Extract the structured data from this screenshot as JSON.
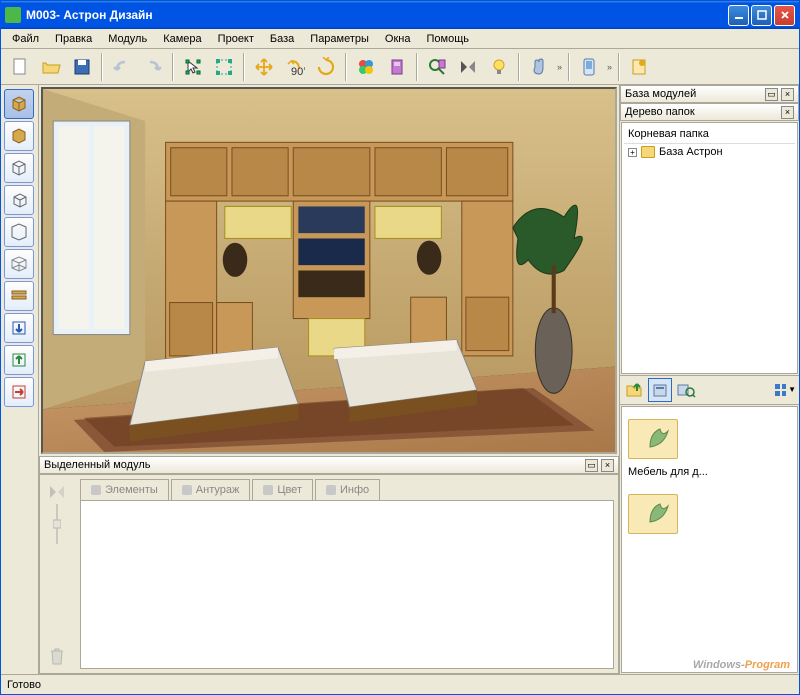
{
  "window": {
    "title": "M003- Астрон Дизайн"
  },
  "menu": {
    "items": [
      "Файл",
      "Правка",
      "Модуль",
      "Камера",
      "Проект",
      "База",
      "Параметры",
      "Окна",
      "Помощь"
    ]
  },
  "toolbar": {
    "icons": [
      "new-file",
      "open-folder",
      "save",
      "undo",
      "redo",
      "pointer",
      "select-box",
      "move",
      "rotate-90",
      "rotate-free",
      "color-palette",
      "door",
      "magnify-door",
      "mirror",
      "lightbulb",
      "hand",
      "phone",
      "export"
    ]
  },
  "left_tools": {
    "icons": [
      "primitive-generic",
      "primitive-box",
      "primitive-cube-front",
      "primitive-cube-back",
      "primitive-cylinder",
      "primitive-wireframe",
      "shelf",
      "arrow-down-blue",
      "arrow-up-green",
      "arrow-right-red"
    ]
  },
  "panels": {
    "selected_module": "Выделенный модуль",
    "tabs": [
      "Элементы",
      "Антураж",
      "Цвет",
      "Инфо"
    ],
    "module_base": "База модулей",
    "folder_tree": "Дерево папок",
    "root_folder": "Корневая папка",
    "tree_items": [
      "База Астрон"
    ]
  },
  "thumbs": {
    "items": [
      "Мебель для д..."
    ]
  },
  "status": {
    "text": "Готово"
  },
  "watermark": {
    "a": "Windows-",
    "b": "Program"
  }
}
